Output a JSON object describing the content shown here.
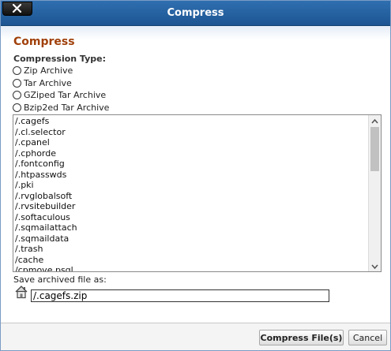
{
  "window": {
    "title": "Compress"
  },
  "dialog": {
    "heading": "Compress",
    "compression_type_label": "Compression Type:",
    "options": [
      {
        "label": "Zip Archive",
        "selected": false
      },
      {
        "label": "Tar Archive",
        "selected": false
      },
      {
        "label": "GZiped Tar Archive",
        "selected": false
      },
      {
        "label": "Bzip2ed Tar Archive",
        "selected": false
      }
    ],
    "files": [
      "/.cagefs",
      "/.cl.selector",
      "/.cpanel",
      "/.cphorde",
      "/.fontconfig",
      "/.htpasswds",
      "/.pki",
      "/.rvglobalsoft",
      "/.rvsitebuilder",
      "/.softaculous",
      "/.sqmailattach",
      "/.sqmaildata",
      "/.trash",
      "/cache",
      "/cpmove.psql"
    ],
    "save_label": "Save archived file as:",
    "save_value": "/.cagefs.zip"
  },
  "buttons": {
    "compress": "Compress File(s)",
    "cancel": "Cancel"
  },
  "icons": {
    "close": "close-icon",
    "home": "home-icon",
    "scroll_up": "arrow-up-icon",
    "scroll_down": "arrow-down-icon"
  },
  "colors": {
    "titlebar": "#1d5592",
    "heading": "#a0400a"
  }
}
